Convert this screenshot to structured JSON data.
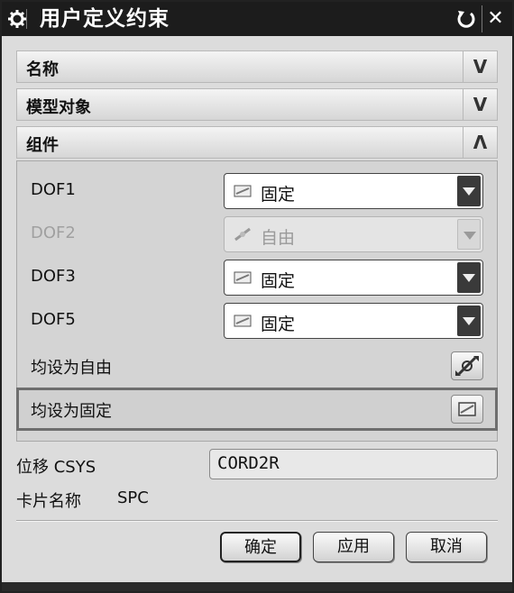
{
  "window": {
    "title": "用户定义约束"
  },
  "sections": {
    "name": {
      "label": "名称",
      "state": "collapsed"
    },
    "model_object": {
      "label": "模型对象",
      "state": "collapsed"
    },
    "component": {
      "label": "组件",
      "state": "expanded"
    }
  },
  "dof_rows": [
    {
      "label": "DOF1",
      "value": "固定",
      "icon": "fixed-icon",
      "enabled": true
    },
    {
      "label": "DOF2",
      "value": "自由",
      "icon": "free-icon",
      "enabled": false
    },
    {
      "label": "DOF3",
      "value": "固定",
      "icon": "fixed-icon",
      "enabled": true
    },
    {
      "label": "DOF5",
      "value": "固定",
      "icon": "fixed-icon",
      "enabled": true
    }
  ],
  "set_all": {
    "free_label": "均设为自由",
    "fixed_label": "均设为固定"
  },
  "displacement_csys": {
    "label": "位移 CSYS",
    "value": "CORD2R"
  },
  "card_name": {
    "label": "卡片名称",
    "value": "SPC"
  },
  "buttons": {
    "ok": "确定",
    "apply": "应用",
    "cancel": "取消"
  }
}
